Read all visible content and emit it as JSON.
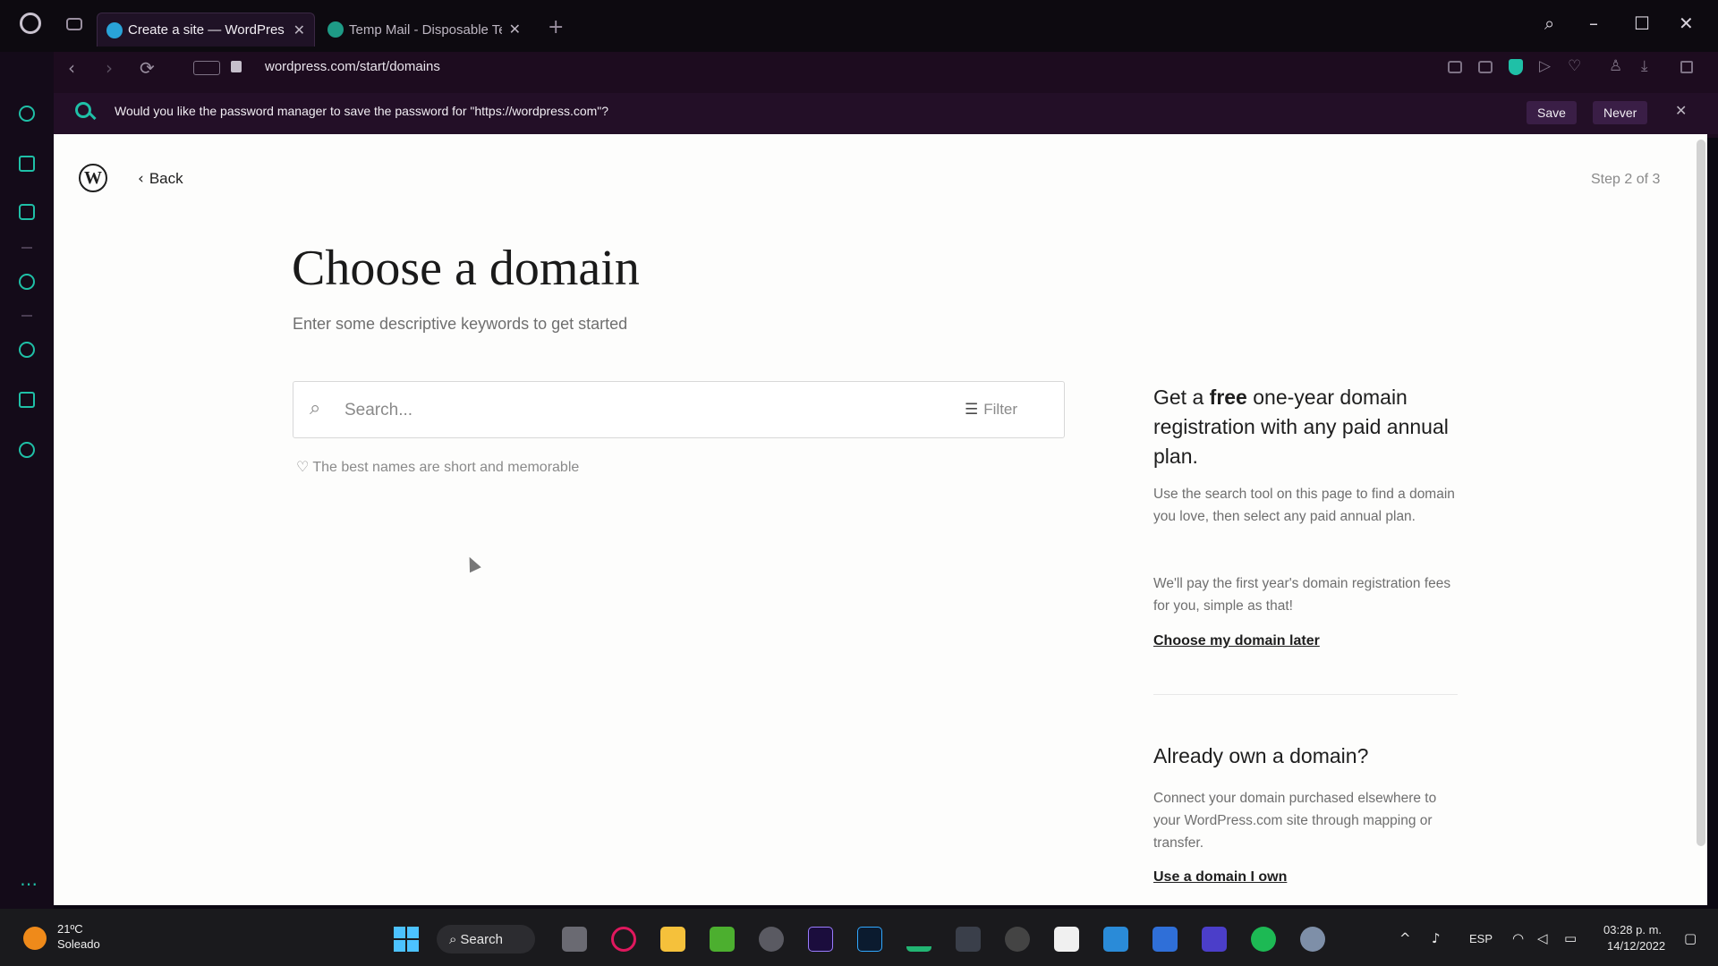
{
  "browser": {
    "tabs": [
      {
        "label": "Create a site — WordPres",
        "active": true
      },
      {
        "label": "Temp Mail - Disposable Te",
        "active": false
      }
    ],
    "url": "wordpress.com/start/domains",
    "password_prompt": {
      "message": "Would you like the password manager to save the password for \"https://wordpress.com\"?",
      "save_label": "Save",
      "never_label": "Never"
    }
  },
  "page": {
    "back_label": "Back",
    "step": "Step 2 of 3",
    "title": "Choose a domain",
    "subtitle": "Enter some descriptive keywords to get started",
    "search": {
      "placeholder": "Search...",
      "filter_label": "Filter"
    },
    "hint": "The best names are short and memorable",
    "aside": {
      "heading_pre": "Get a ",
      "heading_bold": "free",
      "heading_post": " one-year domain registration with any paid annual plan.",
      "para1": "Use the search tool on this page to find a domain you love, then select any paid annual plan.",
      "para2": "We'll pay the first year's domain registration fees for you, simple as that!",
      "choose_later": "Choose my domain later",
      "own_heading": "Already own a domain?",
      "own_para": "Connect your domain purchased elsewhere to your WordPress.com site through mapping or transfer.",
      "own_link": "Use a domain I own"
    }
  },
  "taskbar": {
    "weather_temp": "21ºC",
    "weather_desc": "Soleado",
    "search_label": "Search",
    "lang": "ESP",
    "time": "03:28 p. m.",
    "date": "14/12/2022"
  },
  "colors": {
    "accent": "#1fc0a7",
    "browser_bg": "#1d0c1f",
    "page_bg": "#fdfdfc"
  }
}
